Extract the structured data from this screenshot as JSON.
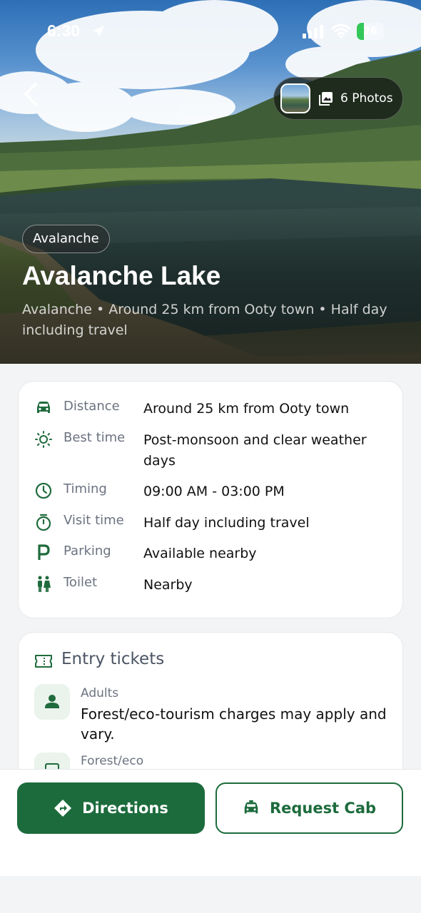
{
  "status_bar": {
    "time": "6:30",
    "battery": "26",
    "battery_level": 0.26
  },
  "hero": {
    "photos_label": "6 Photos",
    "tag": "Avalanche",
    "title": "Avalanche Lake",
    "subtitle": "Avalanche • Around 25 km from Ooty town • Half day including travel"
  },
  "info": [
    {
      "icon": "car-icon",
      "key": "Distance",
      "value": "Around 25 km from Ooty town"
    },
    {
      "icon": "sun-icon",
      "key": "Best time",
      "value": "Post-monsoon and clear weather days"
    },
    {
      "icon": "clock-icon",
      "key": "Timing",
      "value": "09:00 AM - 03:00 PM"
    },
    {
      "icon": "stopwatch-icon",
      "key": "Visit time",
      "value": "Half day including travel"
    },
    {
      "icon": "parking-icon",
      "key": "Parking",
      "value": "Available nearby"
    },
    {
      "icon": "toilet-icon",
      "key": "Toilet",
      "value": "Nearby"
    }
  ],
  "tickets": {
    "title": "Entry tickets",
    "items": [
      {
        "icon": "person-icon",
        "label": "Adults",
        "value": "Forest/eco-tourism charges may apply and vary."
      },
      {
        "icon": "ticket-icon",
        "label": "Forest/eco",
        "value": ""
      }
    ]
  },
  "actions": {
    "directions": "Directions",
    "request_cab": "Request Cab"
  },
  "colors": {
    "accent": "#1c6b3c",
    "icon_green": "#1f6b3d"
  }
}
